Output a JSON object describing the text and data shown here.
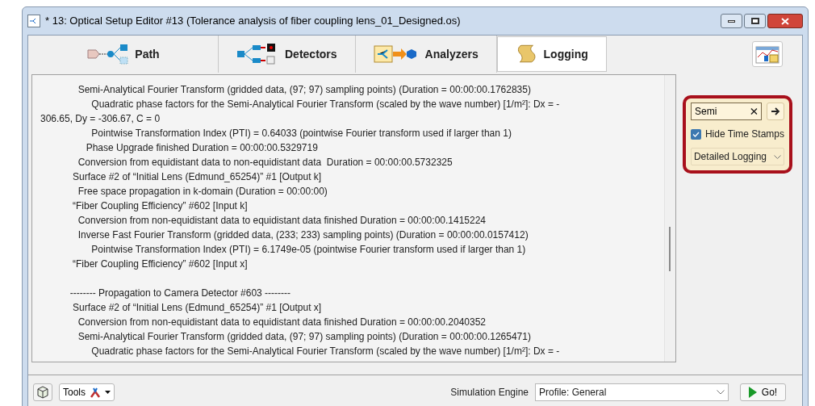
{
  "window": {
    "title": "* 13: Optical Setup Editor #13 (Tolerance analysis of fiber coupling lens_01_Designed.os)"
  },
  "tabs": [
    {
      "label": "Path",
      "kind": "path",
      "selected": false
    },
    {
      "label": "Detectors",
      "kind": "detectors",
      "selected": false
    },
    {
      "label": "Analyzers",
      "kind": "analyzers",
      "selected": false
    },
    {
      "label": "Logging",
      "kind": "logging",
      "selected": true
    }
  ],
  "log": {
    "blocks": [
      [
        "              Semi-Analytical Fourier Transform (gridded data, (97; 97) sampling points) (Duration = 00:00:00.1762835)",
        "                   Quadratic phase factors for the Semi-Analytical Fourier Transform (scaled by the wave number) [1/m²]: Dx = -",
        "306.65, Dy = -306.67, C = 0",
        "                   Pointwise Transformation Index (PTI) = 0.64033 (pointwise Fourier transform used if larger than 1)",
        "                 Phase Upgrade finished Duration = 00:00:00.5329719",
        "              Conversion from equidistant data to non-equidistant data  Duration = 00:00:00.5732325",
        "            Surface #2 of “Initial Lens (Edmund_65254)” #1 [Output k]",
        "              Free space propagation in k-domain (Duration = 00:00:00)",
        "            “Fiber Coupling Efficiency” #602 [Input k]",
        "              Conversion from non-equidistant data to equidistant data finished Duration = 00:00:00.1415224",
        "              Inverse Fast Fourier Transform (gridded data, (233; 233) sampling points) (Duration = 00:00:00.0157412)",
        "                   Pointwise Transformation Index (PTI) = 6.1749e-05 (pointwise Fourier transform used if larger than 1)",
        "            “Fiber Coupling Efficiency” #602 [Input x]"
      ],
      [
        "           -------- Propagation to Camera Detector #603 --------",
        "            Surface #2 of “Initial Lens (Edmund_65254)” #1 [Output x]",
        "              Conversion from non-equidistant data to equidistant data finished Duration = 00:00:00.2040352",
        "              Semi-Analytical Fourier Transform (gridded data, (97; 97) sampling points) (Duration = 00:00:00.1265471)",
        "                   Quadratic phase factors for the Semi-Analytical Fourier Transform (scaled by the wave number) [1/m²]: Dx = -"
      ]
    ]
  },
  "filter": {
    "search": "Semi",
    "hide_time_stamps": {
      "label": "Hide Time Stamps",
      "checked": true
    },
    "level": "Detailed Logging"
  },
  "bottom": {
    "tools": "Tools",
    "engine_label": "Simulation Engine",
    "engine": "Profile: General",
    "go": "Go!"
  }
}
